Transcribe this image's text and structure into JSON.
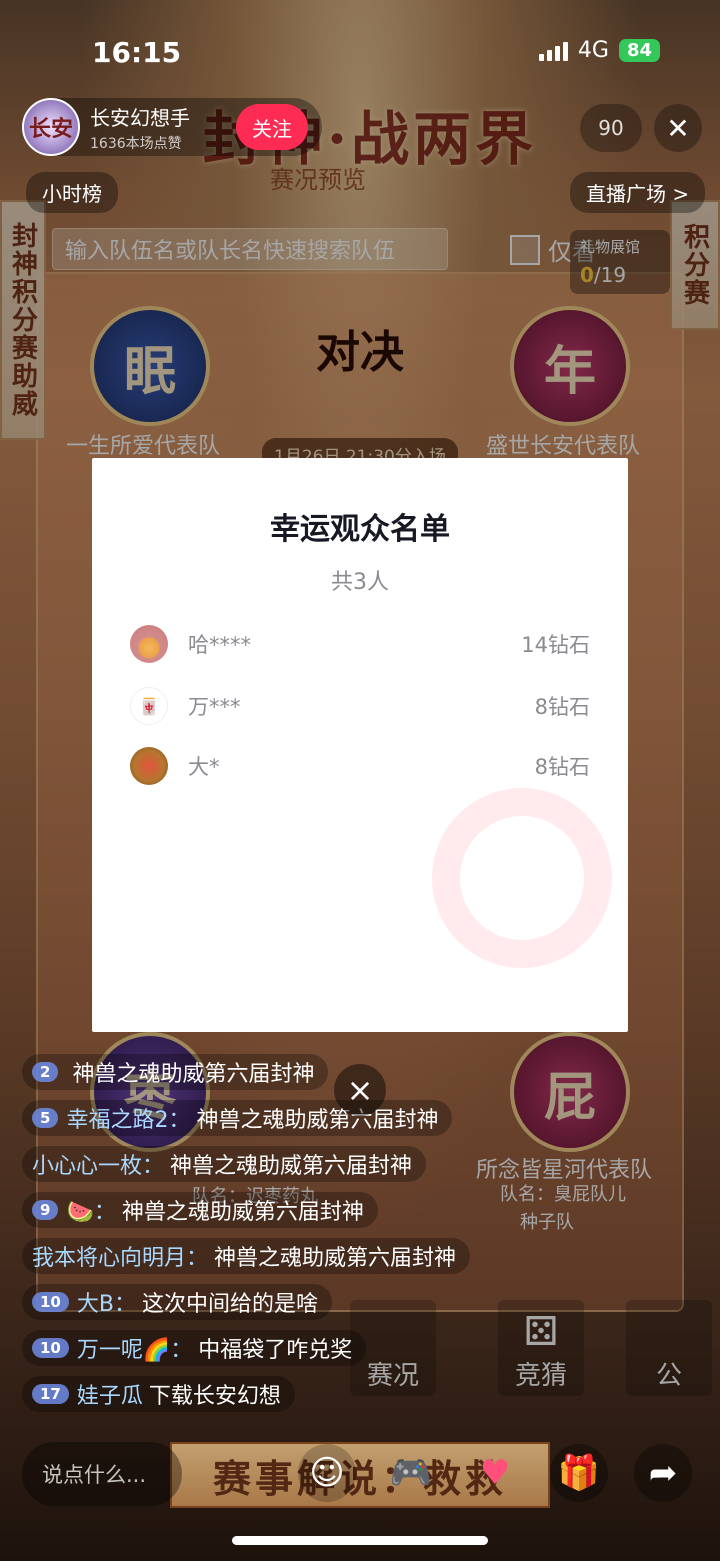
{
  "status_bar": {
    "time": "16:15",
    "network": "4G",
    "battery": "84"
  },
  "header": {
    "host_avatar_text": "长安",
    "host_name": "长安幻想手",
    "host_sub": "1636本场点赞",
    "follow_label": "关注",
    "viewer_count": "90",
    "close_icon": "close-icon",
    "banner_title": "封神·战两界",
    "banner_sub": "赛况预览",
    "tag_left": "小时榜",
    "tag_right": "直播广场 >"
  },
  "background_panel": {
    "side_left": "封神积分赛助威",
    "side_right": "积分赛",
    "search_placeholder": "输入队伍名或队长名快速搜索队伍",
    "only_mine_label": "仅看",
    "gift_title": "礼物展馆",
    "gift_current": "0",
    "gift_total": "/19",
    "teams": [
      {
        "char": "眠",
        "label": "一生所爱代表队"
      },
      {
        "char": "年",
        "label": "盛世长安代表队"
      },
      {
        "char": "枣",
        "label": ""
      },
      {
        "char": "屁",
        "label": "所念皆星河代表队"
      }
    ],
    "versus": "对决",
    "date_tag": "1月26日 21:30分入场",
    "team4_sub": "队名：臭屁队儿",
    "team4_seed": "种子队",
    "team3_sub": "队名：迟枣药丸"
  },
  "modal": {
    "title": "幸运观众名单",
    "count": "共3人",
    "rows": [
      {
        "name": "哈****",
        "value": "14钻石"
      },
      {
        "name": "万***",
        "value": "8钻石"
      },
      {
        "name": "大*",
        "value": "8钻石"
      }
    ],
    "close_symbol": "×"
  },
  "chat": [
    {
      "level": "2",
      "user": "",
      "text": "神兽之魂助威第六届封神"
    },
    {
      "level": "5",
      "user": "幸福之路2：",
      "text": "神兽之魂助威第六届封神"
    },
    {
      "level": "",
      "user": "小心心一枚：",
      "text": "神兽之魂助威第六届封神"
    },
    {
      "level": "9",
      "user": "🍉：",
      "text": "神兽之魂助威第六届封神"
    },
    {
      "level": "",
      "user": "我本将心向明月：",
      "text": "神兽之魂助威第六届封神"
    },
    {
      "level": "10",
      "user": "大B：",
      "text": "这次中间给的是啥"
    },
    {
      "level": "10",
      "user": "万一呢🌈：",
      "text": "中福袋了咋兑奖"
    },
    {
      "level": "17",
      "user": "娃子瓜",
      "text": "下载长安幻想"
    }
  ],
  "tabs": [
    {
      "label": "赛况"
    },
    {
      "label": "竞猜"
    },
    {
      "label": "公"
    }
  ],
  "bottom_bar": {
    "comment_placeholder": "说点什么...",
    "commentary_banner": "赛事解说：救救",
    "icons": [
      "emoji-icon",
      "gamepad-icon",
      "heart-icon",
      "gift-icon",
      "share-icon"
    ]
  }
}
